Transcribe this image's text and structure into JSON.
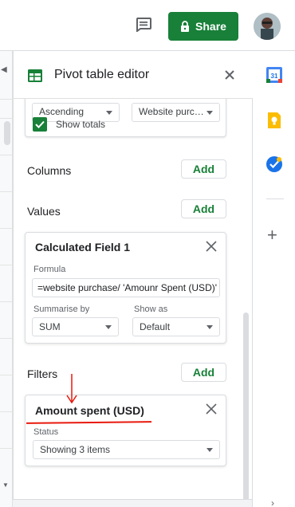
{
  "header": {
    "comment_icon": "comment-icon",
    "share_label": "Share",
    "share_color": "#188038",
    "avatar": "user-avatar"
  },
  "editor": {
    "title": "Pivot table editor",
    "rows_card": {
      "sort_value": "Ascending",
      "by_value": "Website purc…",
      "show_totals_label": "Show totals",
      "show_totals_checked": true
    },
    "columns": {
      "label": "Columns",
      "add_label": "Add"
    },
    "values": {
      "label": "Values",
      "add_label": "Add",
      "card": {
        "title": "Calculated Field 1",
        "formula_label": "Formula",
        "formula_value": "=website purchase/ 'Amounr Spent (USD)'",
        "summarise_label": "Summarise by",
        "summarise_value": "SUM",
        "show_as_label": "Show as",
        "show_as_value": "Default"
      }
    },
    "filters": {
      "label": "Filters",
      "add_label": "Add",
      "card": {
        "title": "Amount spent (USD)",
        "status_label": "Status",
        "status_value": "Showing 3 items"
      }
    }
  },
  "right_rail": {
    "icons": [
      "google-calendar-icon",
      "google-keep-icon",
      "google-tasks-icon",
      "add-icon"
    ],
    "calendar_day": "31"
  },
  "annotation_color": "#e8190d"
}
